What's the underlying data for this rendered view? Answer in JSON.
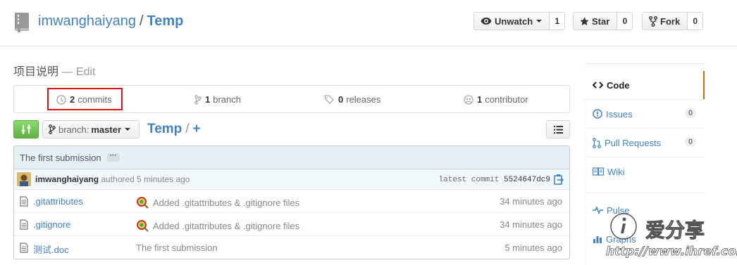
{
  "header": {
    "owner": "imwanghaiyang",
    "separator": "/",
    "repo": "Temp",
    "watch": {
      "label": "Unwatch",
      "count": "1"
    },
    "star": {
      "label": "Star",
      "count": "0"
    },
    "fork": {
      "label": "Fork",
      "count": "0"
    }
  },
  "description": {
    "title": "项目说明",
    "edit": "— Edit"
  },
  "summary": {
    "commits": {
      "count": "2",
      "label": "commits"
    },
    "branches": {
      "count": "1",
      "label": "branch"
    },
    "releases": {
      "count": "0",
      "label": "releases"
    },
    "contributors": {
      "count": "1",
      "label": "contributor"
    }
  },
  "branch_bar": {
    "branch_label": "branch:",
    "branch_value": "master",
    "path_root": "Temp",
    "path_sep": "/",
    "path_add": "+"
  },
  "commit": {
    "message": "The first submission",
    "ellipsis": "···",
    "author": "imwanghaiyang",
    "authored": "authored 5 minutes ago",
    "latest_label": "latest commit",
    "sha": "5524647dc9"
  },
  "files": [
    {
      "name": ".gitattributes",
      "message": "Added .gitattributes & .gitignore files",
      "age": "34 minutes ago",
      "has_emoji": true
    },
    {
      "name": ".gitignore",
      "message": "Added .gitattributes & .gitignore files",
      "age": "34 minutes ago",
      "has_emoji": true
    },
    {
      "name": "测试.doc",
      "message": "The first submission",
      "age": "5 minutes ago",
      "has_emoji": false
    }
  ],
  "sidebar": {
    "items": [
      {
        "label": "Code",
        "icon": "code-icon",
        "selected": true
      },
      {
        "label": "Issues",
        "icon": "issue-icon",
        "count": "0"
      },
      {
        "label": "Pull Requests",
        "icon": "pull-request-icon",
        "count": "0"
      },
      {
        "label": "Wiki",
        "icon": "book-icon"
      },
      {
        "label": "Pulse",
        "icon": "pulse-icon"
      },
      {
        "label": "Graphs",
        "icon": "graph-icon"
      }
    ]
  },
  "watermark": {
    "text": "爱分享",
    "url": "http://www.ihref.com"
  },
  "colors": {
    "link": "#4183c4",
    "highlight": "#e01010",
    "compare_green": "#60b044",
    "selected_bar": "#d26911"
  }
}
